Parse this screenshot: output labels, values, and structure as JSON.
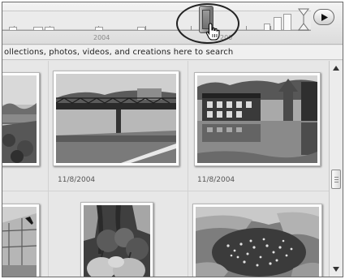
{
  "timeline": {
    "year_label": "2004",
    "year_label_partial": "200"
  },
  "search_hint": {
    "text": "ollections, photos, videos, and creations here to search"
  },
  "photos": [
    {
      "name": "photo-left-partial-1",
      "caption": ""
    },
    {
      "name": "photo-bridge",
      "caption": "11/8/2004"
    },
    {
      "name": "photo-flooded-building",
      "caption": "11/8/2004"
    },
    {
      "name": "photo-left-partial-2",
      "caption": ""
    },
    {
      "name": "photo-pumpkins",
      "caption": ""
    },
    {
      "name": "photo-gravel-tarp",
      "caption": ""
    }
  ],
  "icons": {
    "cursor": "hand-pointer-icon",
    "play": "play-icon",
    "range_marker": "range-end-marker-icon",
    "scroll_up": "scroll-up-arrow-icon",
    "scroll_down": "scroll-down-arrow-icon"
  },
  "colors": {
    "timeline_bg": "#e8e8e8",
    "grid_bg": "#e7e7e7",
    "handle": "#8f8f8f"
  }
}
